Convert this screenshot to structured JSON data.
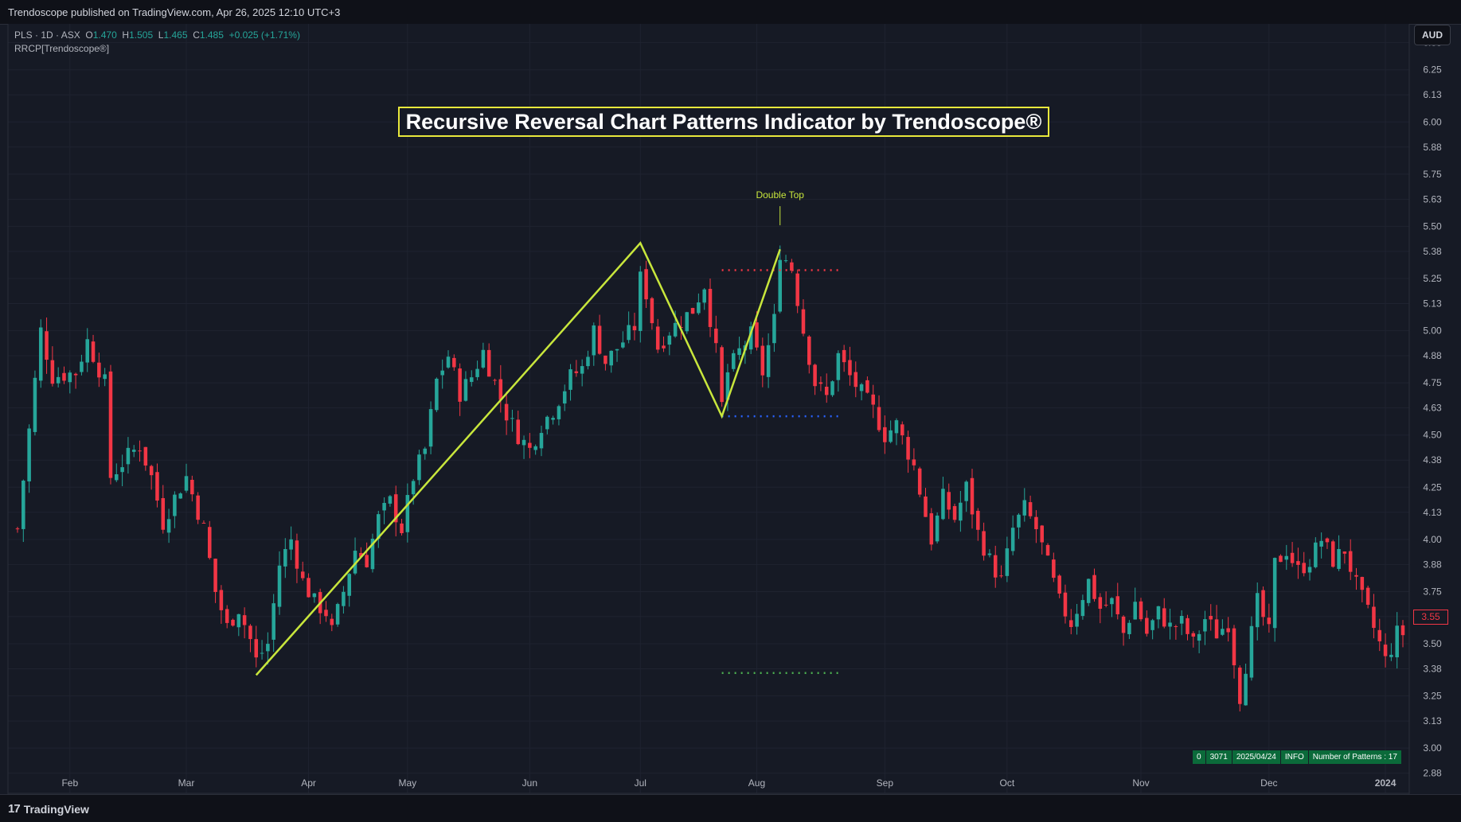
{
  "publisher_line": "Trendoscope published on TradingView.com, Apr 26, 2025 12:10 UTC+3",
  "footer": {
    "logo_text": "TradingView",
    "logo_mark": "17"
  },
  "legend": {
    "symbol": "PLS · 1D · ASX",
    "o_label": "O",
    "o": "1.470",
    "h_label": "H",
    "h": "1.505",
    "l_label": "L",
    "l": "1.465",
    "c_label": "C",
    "c": "1.485",
    "change": "+0.025 (+1.71%)",
    "indicator": "RRCP[Trendoscope®]"
  },
  "currency": "AUD",
  "last_price": "3.55",
  "info_table": {
    "cells": [
      "0",
      "3071",
      "2025/04/24",
      "INFO",
      "Number of Patterns : 17"
    ]
  },
  "colors": {
    "up": "#26a69a",
    "down": "#f23645",
    "zigzag": "#c8e63c",
    "title_border": "#e8e83c",
    "pattern_label": "#c8e63c"
  },
  "chart_data": {
    "type": "candlestick",
    "title": "Recursive Reversal Chart Patterns Indicator by Trendoscope®",
    "xlabel": "",
    "ylabel": "",
    "ylim": [
      2.81,
      6.47
    ],
    "yticks": [
      "6.38",
      "6.25",
      "6.13",
      "6.00",
      "5.88",
      "5.75",
      "5.63",
      "5.50",
      "5.38",
      "5.25",
      "5.13",
      "5.00",
      "4.88",
      "4.75",
      "4.63",
      "4.50",
      "4.38",
      "4.25",
      "4.13",
      "4.00",
      "3.88",
      "3.75",
      "3.63",
      "3.50",
      "3.38",
      "3.25",
      "3.13",
      "3.00",
      "2.88"
    ],
    "xlim": [
      0,
      238
    ],
    "xticks": [
      {
        "label": "Feb",
        "x": 9
      },
      {
        "label": "Mar",
        "x": 29
      },
      {
        "label": "Apr",
        "x": 50
      },
      {
        "label": "May",
        "x": 67
      },
      {
        "label": "Jun",
        "x": 88
      },
      {
        "label": "Jul",
        "x": 107
      },
      {
        "label": "Aug",
        "x": 127
      },
      {
        "label": "Sep",
        "x": 149
      },
      {
        "label": "Oct",
        "x": 170
      },
      {
        "label": "Nov",
        "x": 193
      },
      {
        "label": "Dec",
        "x": 215
      },
      {
        "label": "2024",
        "x": 235
      }
    ],
    "close_anchors": [
      [
        0,
        4.05
      ],
      [
        3,
        4.76
      ],
      [
        4,
        5.0
      ],
      [
        6,
        4.78
      ],
      [
        10,
        4.8
      ],
      [
        12,
        4.95
      ],
      [
        15,
        4.75
      ],
      [
        16,
        4.3
      ],
      [
        19,
        4.4
      ],
      [
        21,
        4.45
      ],
      [
        23,
        4.3
      ],
      [
        25,
        4.08
      ],
      [
        27,
        4.2
      ],
      [
        29,
        4.3
      ],
      [
        32,
        4.05
      ],
      [
        34,
        3.75
      ],
      [
        36,
        3.58
      ],
      [
        38,
        3.67
      ],
      [
        40,
        3.52
      ],
      [
        41,
        3.42
      ],
      [
        43,
        3.5
      ],
      [
        45,
        3.88
      ],
      [
        47,
        4.0
      ],
      [
        49,
        3.8
      ],
      [
        51,
        3.7
      ],
      [
        53,
        3.65
      ],
      [
        54,
        3.56
      ],
      [
        56,
        3.75
      ],
      [
        58,
        3.95
      ],
      [
        60,
        3.9
      ],
      [
        62,
        4.1
      ],
      [
        64,
        4.18
      ],
      [
        66,
        4.05
      ],
      [
        68,
        4.3
      ],
      [
        70,
        4.43
      ],
      [
        72,
        4.76
      ],
      [
        74,
        4.88
      ],
      [
        76,
        4.7
      ],
      [
        78,
        4.78
      ],
      [
        80,
        4.9
      ],
      [
        82,
        4.75
      ],
      [
        84,
        4.6
      ],
      [
        86,
        4.5
      ],
      [
        88,
        4.43
      ],
      [
        90,
        4.55
      ],
      [
        92,
        4.62
      ],
      [
        95,
        4.78
      ],
      [
        97,
        4.82
      ],
      [
        99,
        5.0
      ],
      [
        101,
        4.85
      ],
      [
        104,
        4.95
      ],
      [
        106,
        5.02
      ],
      [
        107,
        5.25
      ],
      [
        108,
        5.18
      ],
      [
        110,
        4.92
      ],
      [
        112,
        5.0
      ],
      [
        114,
        5.05
      ],
      [
        116,
        5.1
      ],
      [
        118,
        5.22
      ],
      [
        120,
        4.9
      ],
      [
        121,
        4.64
      ],
      [
        122,
        4.8
      ],
      [
        124,
        4.9
      ],
      [
        126,
        4.98
      ],
      [
        128,
        4.8
      ],
      [
        130,
        5.05
      ],
      [
        131,
        5.38
      ],
      [
        133,
        5.3
      ],
      [
        135,
        5.0
      ],
      [
        137,
        4.75
      ],
      [
        139,
        4.68
      ],
      [
        141,
        4.88
      ],
      [
        143,
        4.78
      ],
      [
        145,
        4.7
      ],
      [
        147,
        4.62
      ],
      [
        149,
        4.5
      ],
      [
        151,
        4.55
      ],
      [
        154,
        4.35
      ],
      [
        157,
        4.0
      ],
      [
        159,
        4.2
      ],
      [
        161,
        4.1
      ],
      [
        163,
        4.25
      ],
      [
        165,
        4.03
      ],
      [
        167,
        3.9
      ],
      [
        169,
        3.8
      ],
      [
        171,
        4.05
      ],
      [
        173,
        4.15
      ],
      [
        175,
        4.05
      ],
      [
        177,
        3.88
      ],
      [
        179,
        3.7
      ],
      [
        181,
        3.6
      ],
      [
        184,
        3.8
      ],
      [
        186,
        3.67
      ],
      [
        188,
        3.7
      ],
      [
        190,
        3.55
      ],
      [
        192,
        3.7
      ],
      [
        194,
        3.55
      ],
      [
        196,
        3.65
      ],
      [
        198,
        3.58
      ],
      [
        200,
        3.6
      ],
      [
        202,
        3.5
      ],
      [
        204,
        3.62
      ],
      [
        206,
        3.55
      ],
      [
        208,
        3.6
      ],
      [
        210,
        3.25
      ],
      [
        211,
        3.4
      ],
      [
        213,
        3.7
      ],
      [
        215,
        3.55
      ],
      [
        216,
        3.88
      ],
      [
        218,
        3.95
      ],
      [
        220,
        3.85
      ],
      [
        222,
        3.9
      ],
      [
        224,
        4.0
      ],
      [
        226,
        3.9
      ],
      [
        228,
        3.95
      ],
      [
        230,
        3.78
      ],
      [
        232,
        3.65
      ],
      [
        234,
        3.5
      ],
      [
        235,
        3.42
      ],
      [
        236,
        3.48
      ],
      [
        237,
        3.55
      ],
      [
        238,
        3.55
      ]
    ],
    "zigzag": [
      [
        41,
        3.35
      ],
      [
        107,
        5.42
      ],
      [
        121,
        4.59
      ],
      [
        131,
        5.39
      ]
    ],
    "pattern": {
      "name": "Double Top",
      "label_x": 131,
      "label_y": 5.65,
      "top_level": 5.29,
      "neckline": 4.59,
      "target": 3.36,
      "x_from": 121,
      "x_to": 141
    }
  }
}
